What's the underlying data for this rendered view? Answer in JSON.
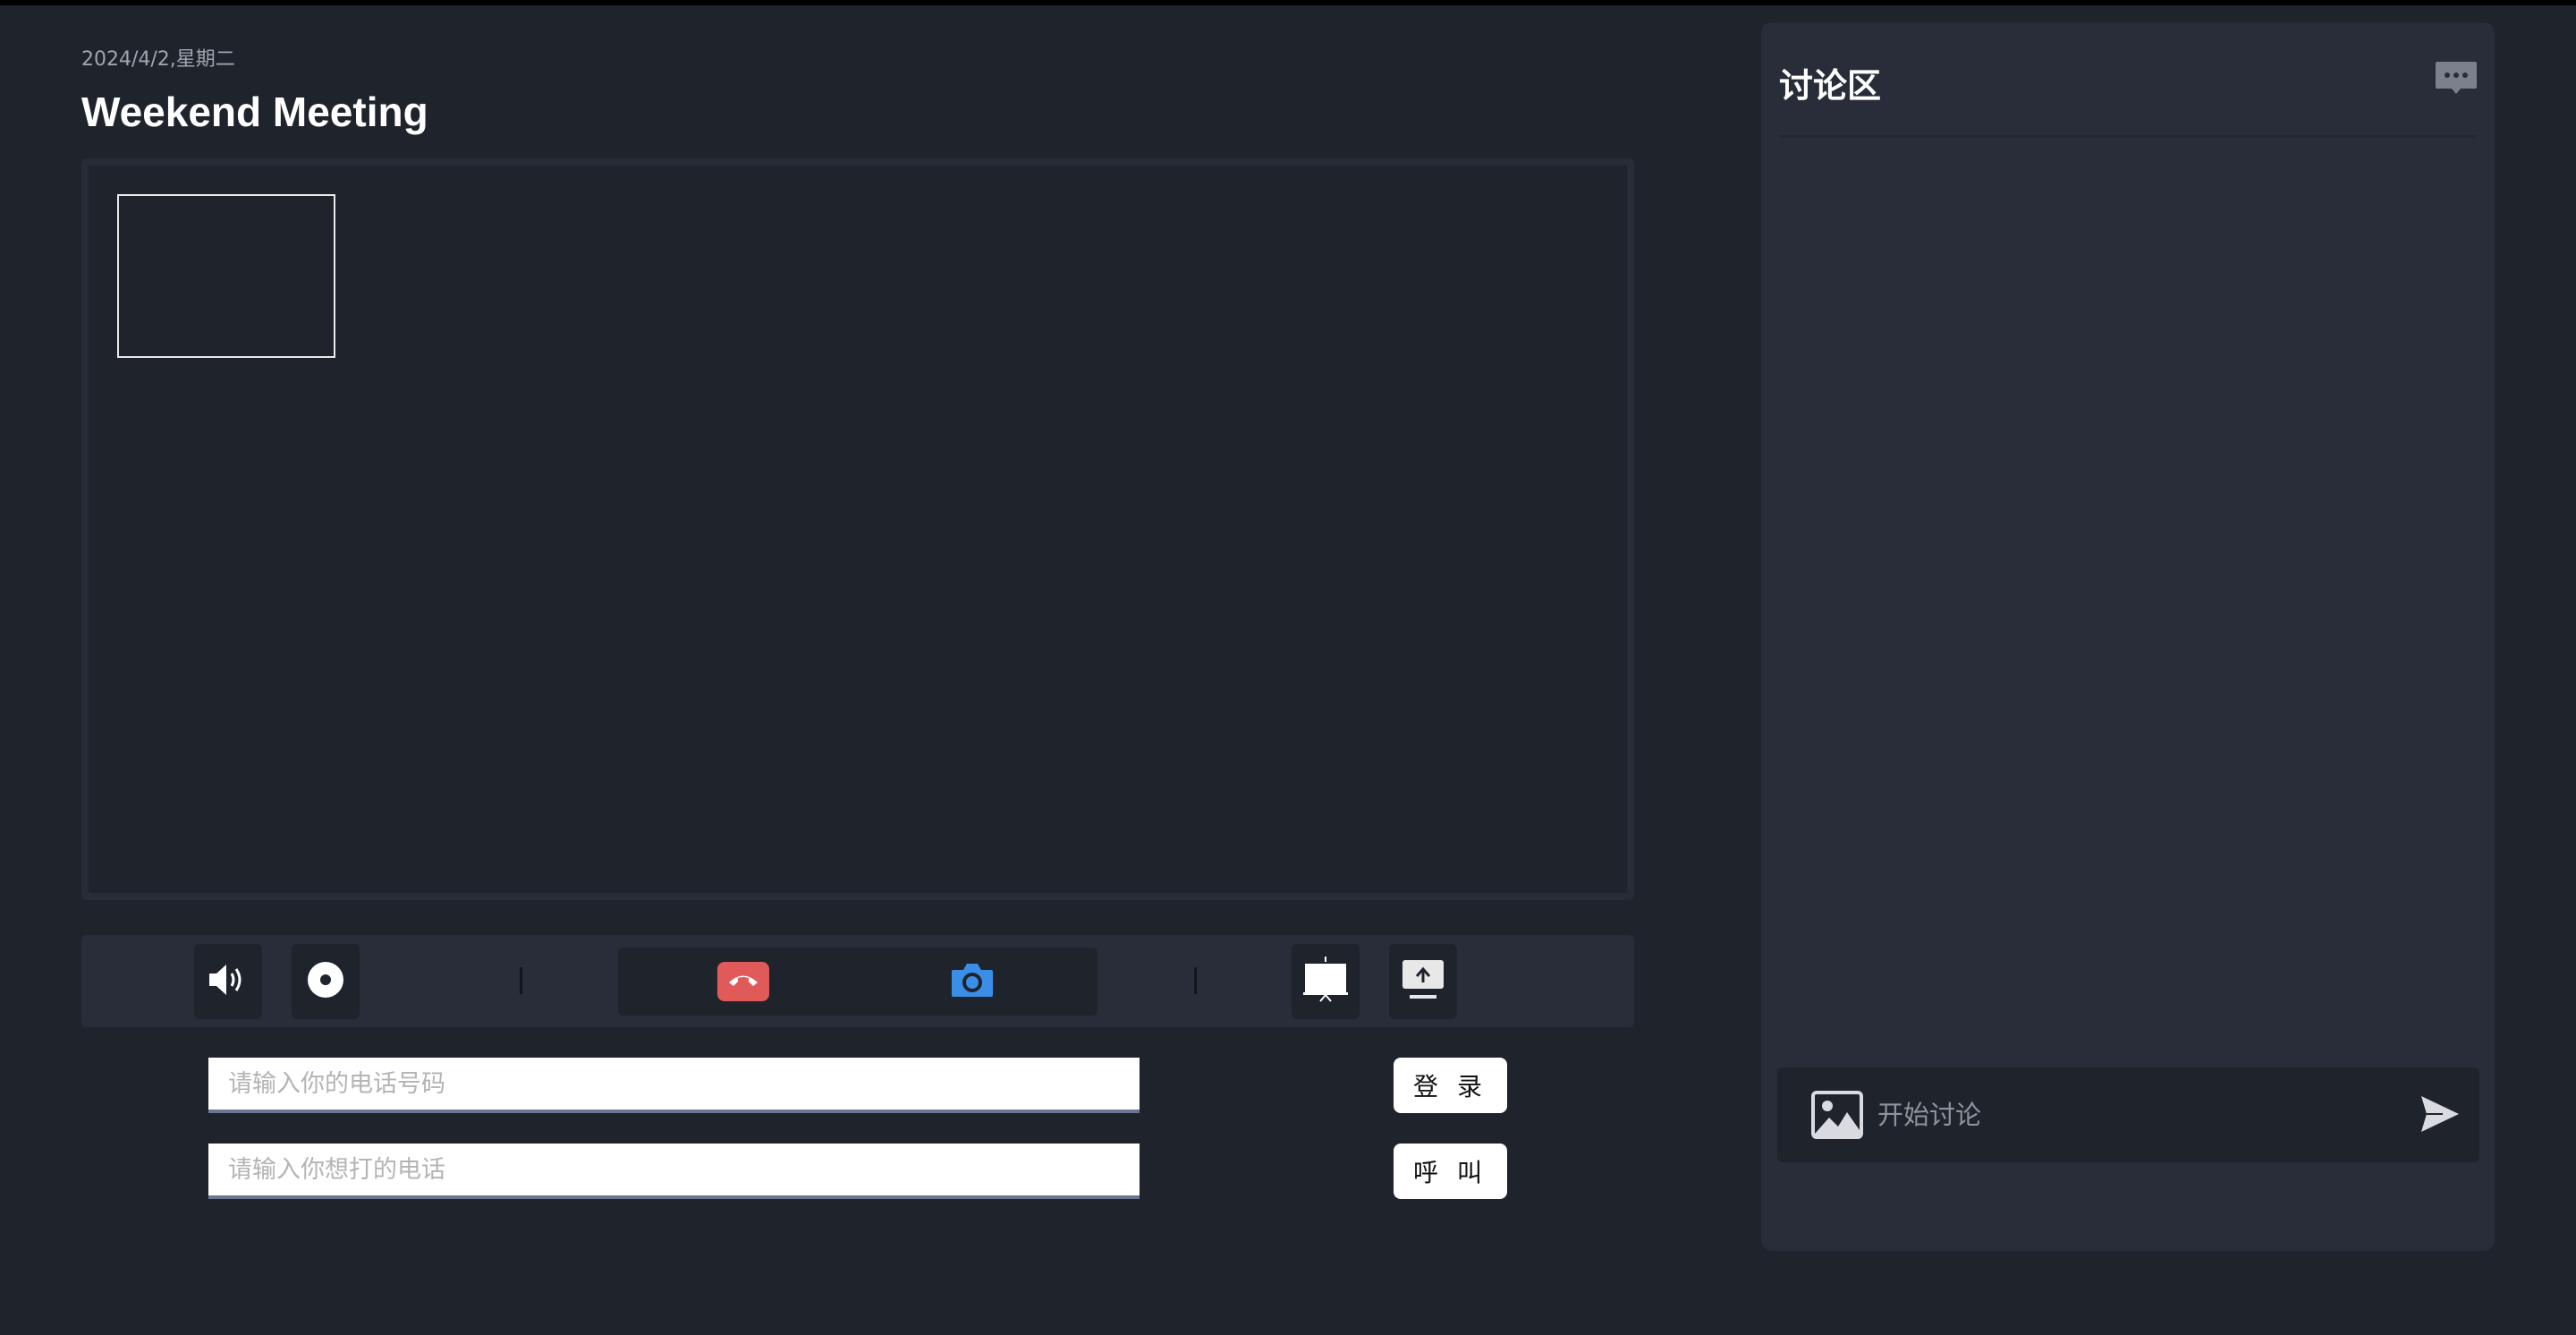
{
  "header": {
    "date": "2024/4/2,星期二",
    "title": "Weekend Meeting"
  },
  "controls": {
    "icons": [
      "speaker-icon",
      "record-icon",
      "hangup-icon",
      "camera-icon",
      "presentation-icon",
      "screen-share-icon"
    ],
    "colors": {
      "hangup": "#e05a59",
      "camera": "#3a8ee6"
    }
  },
  "form": {
    "phone_placeholder": "请输入你的电话号码",
    "login_label": "登 录",
    "dial_placeholder": "请输入你想打的电话",
    "call_label": "呼 叫"
  },
  "discussion": {
    "title": "讨论区",
    "input_placeholder": "开始讨论",
    "icons": [
      "chat-bubble-icon",
      "image-icon",
      "send-icon"
    ]
  }
}
